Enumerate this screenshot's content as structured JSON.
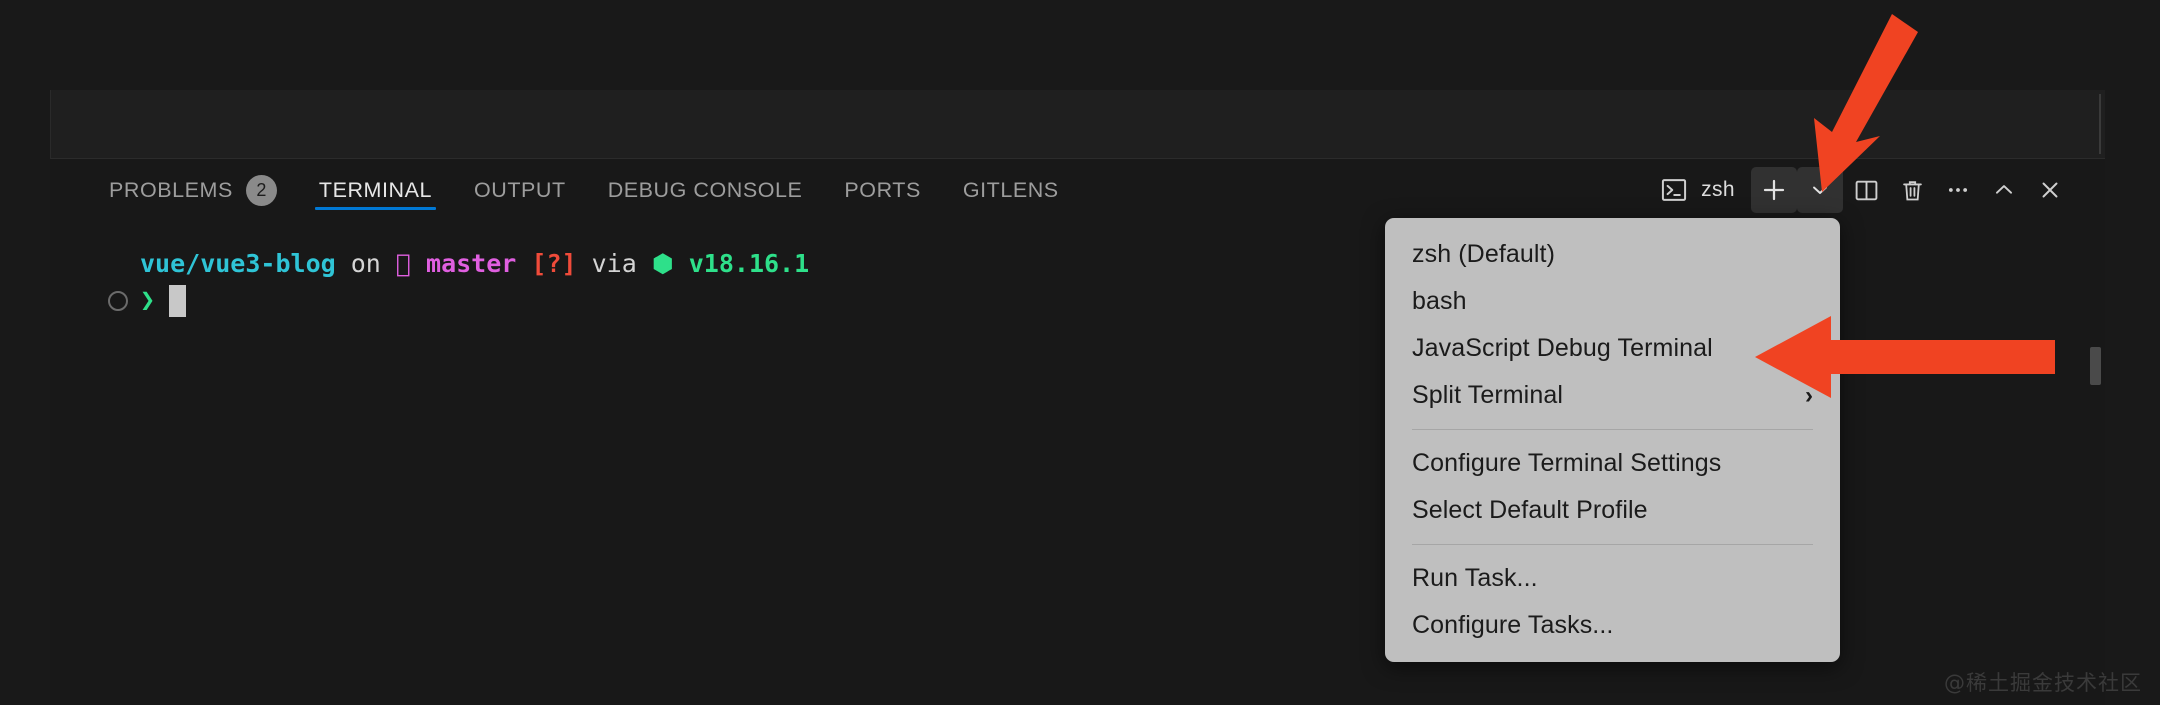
{
  "panel": {
    "tabs": [
      {
        "label": "PROBLEMS",
        "badge": "2",
        "active": false
      },
      {
        "label": "TERMINAL",
        "active": true
      },
      {
        "label": "OUTPUT",
        "active": false
      },
      {
        "label": "DEBUG CONSOLE",
        "active": false
      },
      {
        "label": "PORTS",
        "active": false
      },
      {
        "label": "GITLENS",
        "active": false
      }
    ],
    "toolbar": {
      "shell_name": "zsh",
      "terminal_icon": "terminal-icon",
      "new_terminal_icon": "plus-icon",
      "profile_dropdown_icon": "chevron-down-icon",
      "split_icon": "split-editor-icon",
      "kill_icon": "trash-icon",
      "more_icon": "ellipsis-icon",
      "maximize_icon": "chevron-up-icon",
      "close_icon": "close-icon"
    }
  },
  "terminal": {
    "prompt": {
      "path": "vue/vue3-blog",
      "on_word": "on",
      "branch_glyph": "",
      "branch": "master",
      "dirty": "[?]",
      "via_word": "via",
      "node_glyph": "⬢",
      "node_version": "v18.16.1",
      "chevron": "❯",
      "input": ""
    }
  },
  "context_menu": {
    "items": [
      {
        "label": "zsh (Default)",
        "type": "item"
      },
      {
        "label": "bash",
        "type": "item"
      },
      {
        "label": "JavaScript Debug Terminal",
        "type": "item"
      },
      {
        "label": "Split Terminal",
        "type": "item",
        "submenu": "›"
      },
      {
        "type": "separator"
      },
      {
        "label": "Configure Terminal Settings",
        "type": "item"
      },
      {
        "label": "Select Default Profile",
        "type": "item"
      },
      {
        "type": "separator"
      },
      {
        "label": "Run Task...",
        "type": "item"
      },
      {
        "label": "Configure Tasks...",
        "type": "item"
      }
    ]
  },
  "annotations": {
    "arrow_color": "#f04322",
    "arrow_down": "arrow-pointing-to-profile-dropdown",
    "arrow_left": "arrow-pointing-to-javascript-debug-terminal"
  },
  "watermark": {
    "text": "@稀土掘金技术社区"
  },
  "colors": {
    "accent": "#0078d4",
    "panel_bg": "#181818",
    "menu_bg": "#bfbfbf",
    "path": "#2fc4d6",
    "branch": "#e05fe0",
    "dirty": "#f04b3a",
    "node": "#2ee08a"
  }
}
